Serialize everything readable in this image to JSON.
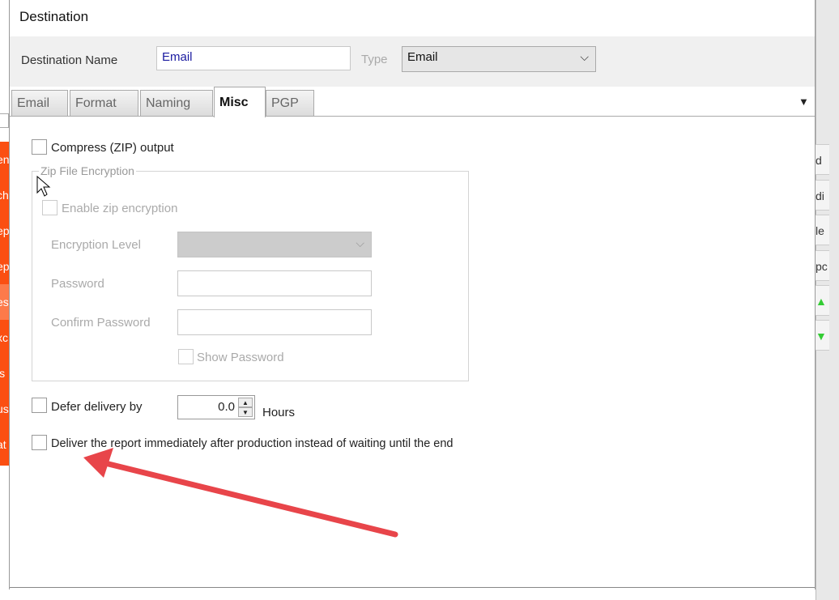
{
  "dialog": {
    "title": "Destination"
  },
  "header": {
    "name_label": "Destination Name",
    "name_value": "Email",
    "type_label": "Type",
    "type_value": "Email"
  },
  "tabs": [
    {
      "label": "Email"
    },
    {
      "label": "Format"
    },
    {
      "label": "Naming"
    },
    {
      "label": "Misc",
      "active": true
    },
    {
      "label": "PGP"
    }
  ],
  "misc": {
    "compress_label": "Compress (ZIP) output",
    "compress_checked": false,
    "zip_group_label": "Zip File Encryption",
    "enable_encryption_label": "Enable zip encryption",
    "encryption_level_label": "Encryption Level",
    "encryption_level_value": "",
    "password_label": "Password",
    "password_value": "",
    "confirm_password_label": "Confirm Password",
    "confirm_password_value": "",
    "show_password_label": "Show Password",
    "defer_label": "Defer delivery by",
    "defer_value": "0.0",
    "defer_unit": "Hours",
    "deliver_label": "Deliver the report immediately after production instead of waiting until the end",
    "deliver_checked": false
  },
  "background": {
    "left_fragments": [
      "en",
      "ch",
      "ep",
      "ep",
      "es",
      "xc",
      "is",
      "us",
      "at"
    ],
    "right_fragments": [
      "d",
      "di",
      "le",
      "pc"
    ]
  },
  "colors": {
    "accent_orange": "#fb4f12",
    "arrow_red": "#e8454a",
    "name_text": "#1a1aa0"
  }
}
